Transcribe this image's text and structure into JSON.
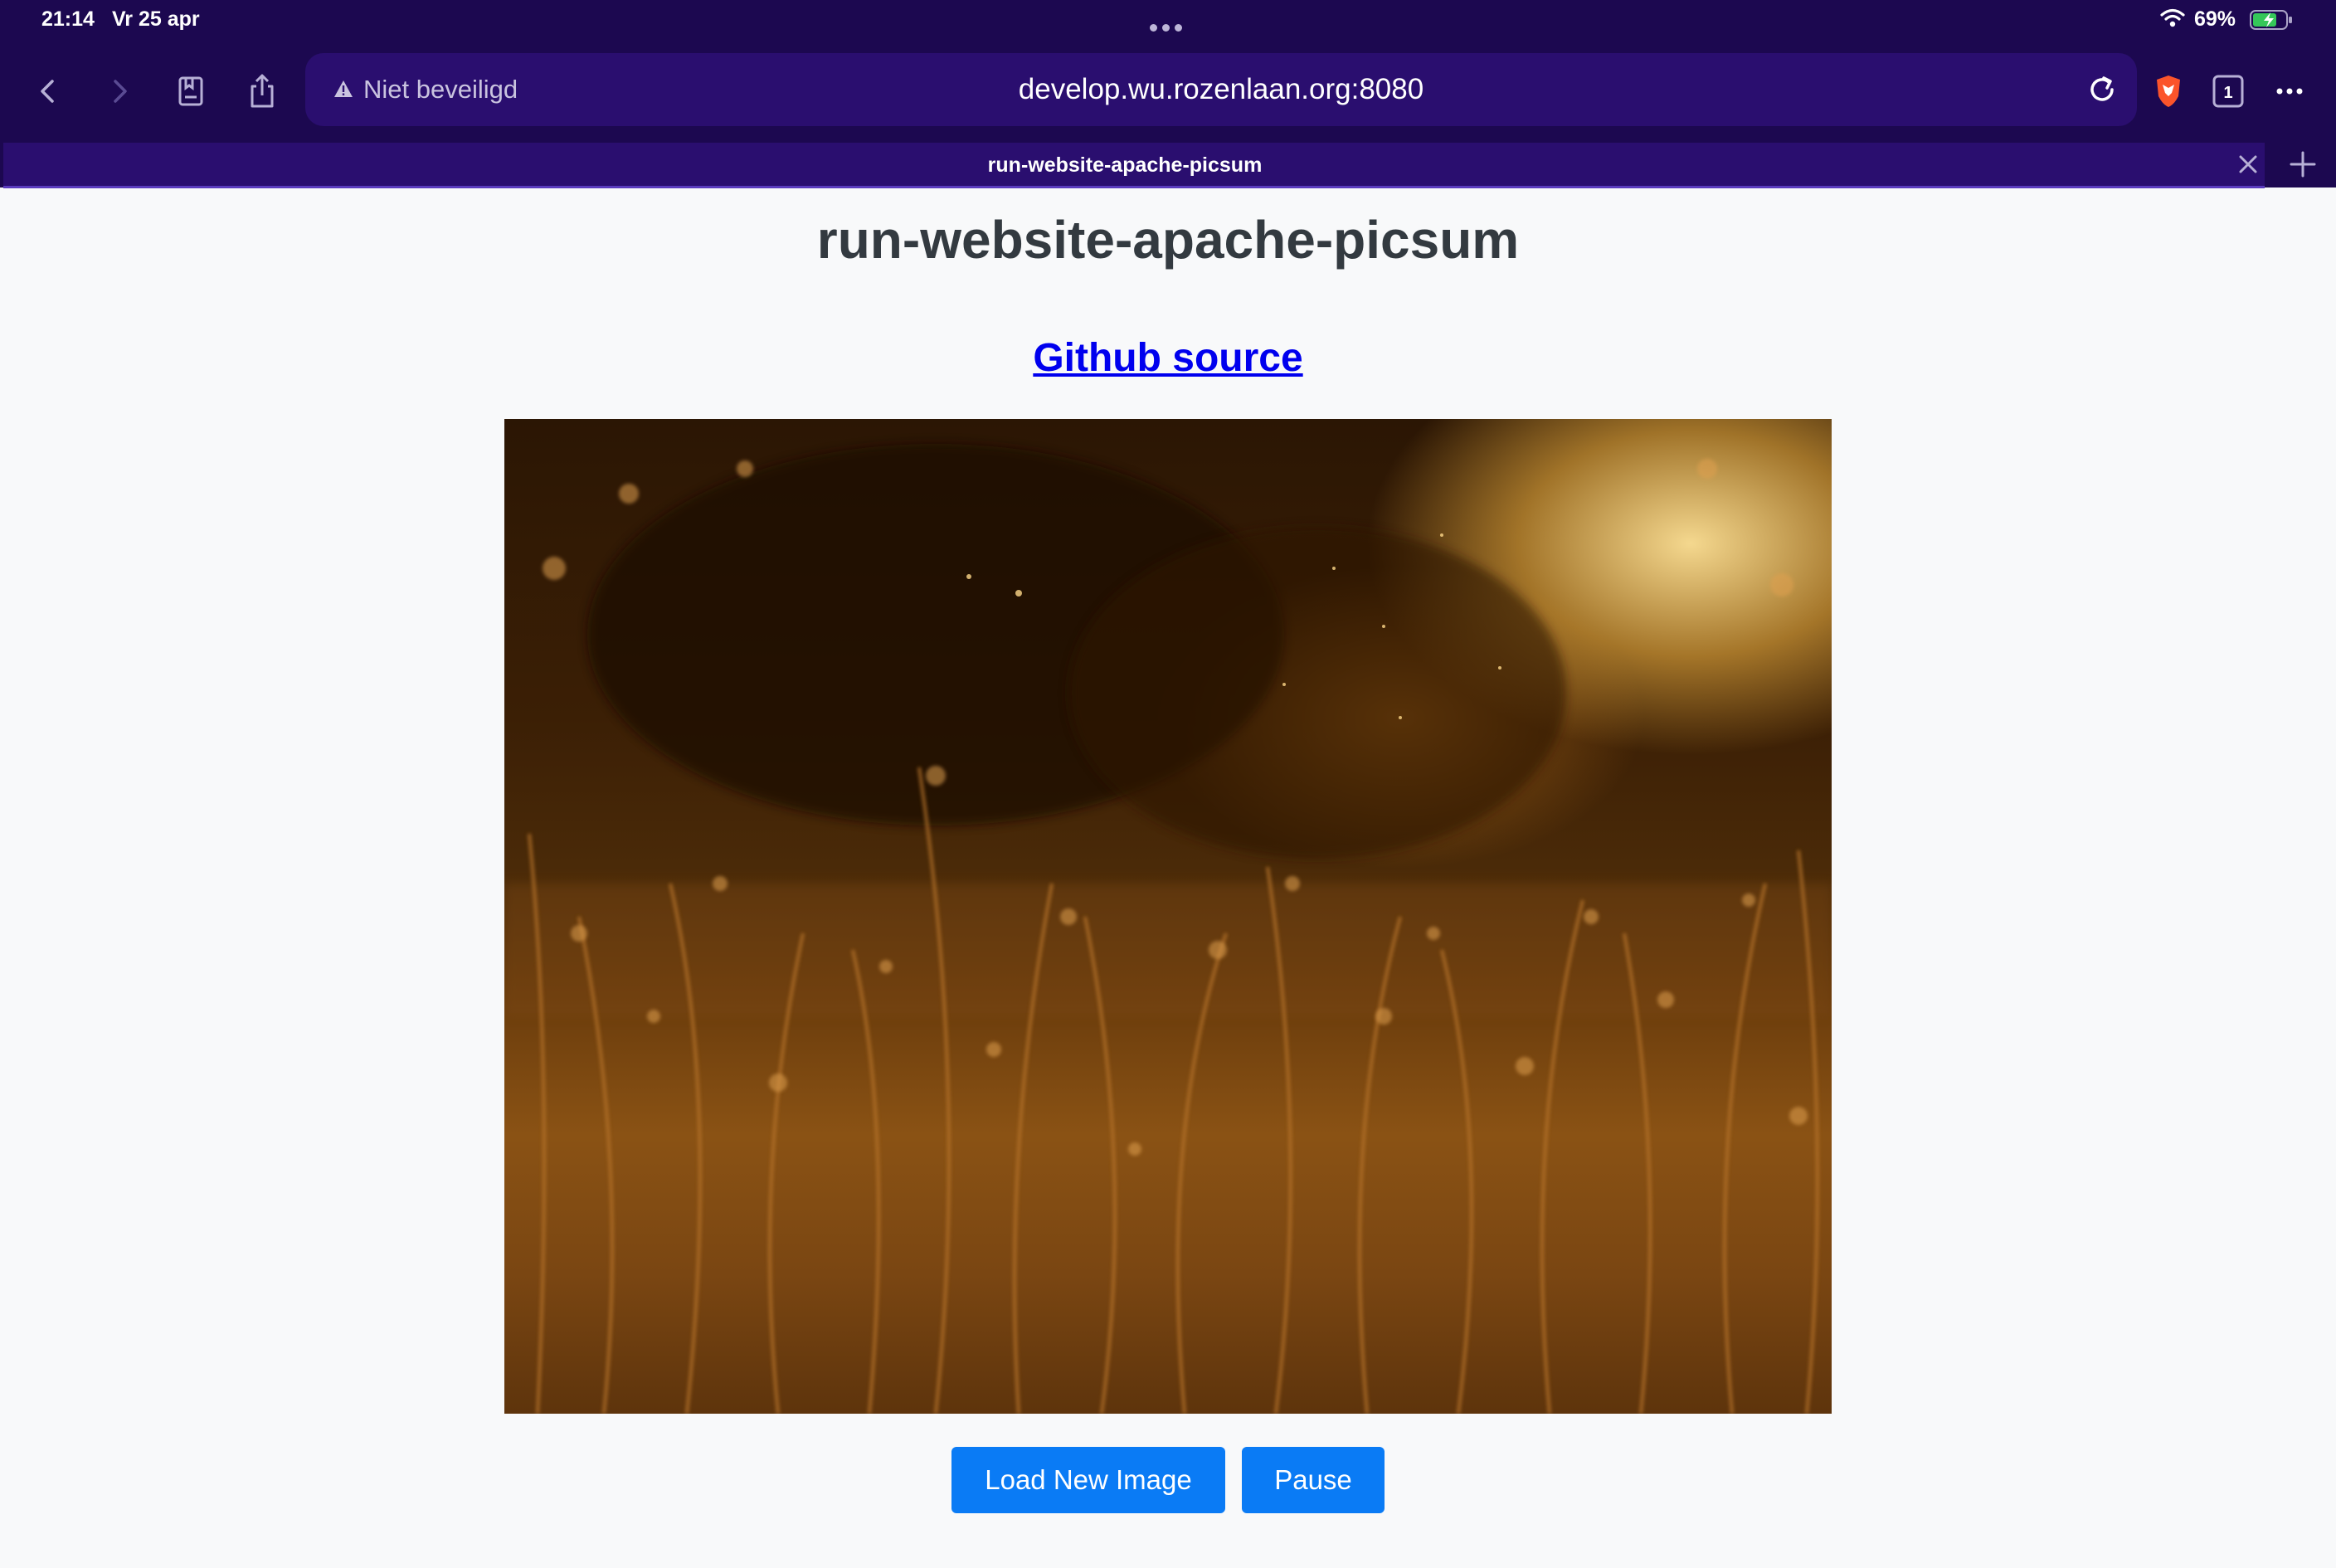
{
  "status_bar": {
    "time": "21:14",
    "date": "Vr 25 apr",
    "battery": "69%",
    "icons": [
      "wifi-icon",
      "battery-charging-icon"
    ]
  },
  "browser": {
    "address_bar": {
      "security_label": "Niet beveiligd",
      "url": "develop.wu.rozenlaan.org:8080"
    },
    "tab_count": "1",
    "active_tab": {
      "title": "run-website-apache-picsum"
    },
    "icons": [
      "back-icon",
      "forward-icon",
      "bookmarks-icon",
      "share-icon",
      "warning-icon",
      "reload-icon",
      "brave-shield-icon",
      "tabs-icon",
      "more-icon",
      "close-icon",
      "plus-icon"
    ],
    "colors": {
      "chrome": "#1c0850",
      "address_bar": "#2a0e6f"
    }
  },
  "page": {
    "title": "run-website-apache-picsum",
    "github_link": "Github source",
    "image_alt": "Golden backlit wild grass at sunset",
    "buttons": {
      "load_new_image": "Load New Image",
      "pause": "Pause"
    },
    "colors": {
      "link": "#0000ee",
      "button": "#0a7bf5",
      "background": "#f8f9fa"
    }
  }
}
